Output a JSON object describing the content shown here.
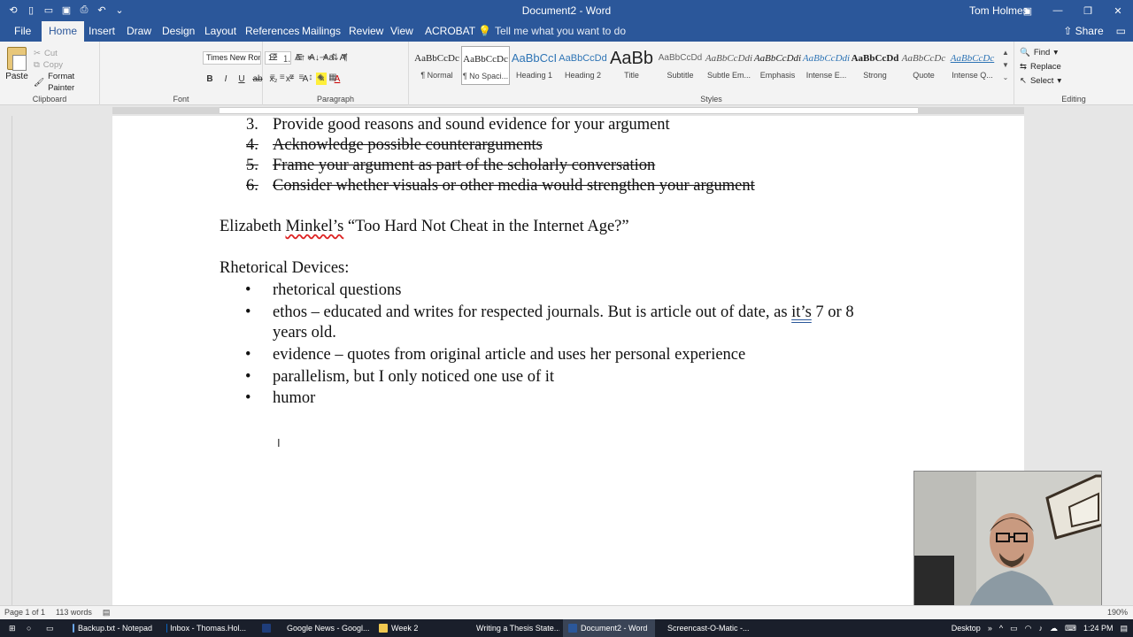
{
  "window": {
    "title": "Document2 - Word",
    "user": "Tom Holmes"
  },
  "tabs": [
    {
      "label": "File"
    },
    {
      "label": "Home"
    },
    {
      "label": "Insert"
    },
    {
      "label": "Draw"
    },
    {
      "label": "Design"
    },
    {
      "label": "Layout"
    },
    {
      "label": "References"
    },
    {
      "label": "Mailings"
    },
    {
      "label": "Review"
    },
    {
      "label": "View"
    },
    {
      "label": "ACROBAT"
    }
  ],
  "tell_me": "Tell me what you want to do",
  "share_label": "Share",
  "ribbon": {
    "clipboard": {
      "paste": "Paste",
      "cut": "Cut",
      "copy": "Copy",
      "format_painter": "Format Painter",
      "label": "Clipboard"
    },
    "font": {
      "name": "Times New Roman",
      "size": "12",
      "label": "Font"
    },
    "paragraph": {
      "label": "Paragraph"
    },
    "styles": {
      "label": "Styles",
      "items": [
        {
          "preview": "AaBbCcDc",
          "name": "¶ Normal"
        },
        {
          "preview": "AaBbCcDc",
          "name": "¶ No Spaci..."
        },
        {
          "preview": "AaBbCcI",
          "name": "Heading 1"
        },
        {
          "preview": "AaBbCcDd",
          "name": "Heading 2"
        },
        {
          "preview": "AaBb",
          "name": "Title"
        },
        {
          "preview": "AaBbCcDd",
          "name": "Subtitle"
        },
        {
          "preview": "AaBbCcDdi",
          "name": "Subtle Em..."
        },
        {
          "preview": "AaBbCcDdi",
          "name": "Emphasis"
        },
        {
          "preview": "AaBbCcDdi",
          "name": "Intense E..."
        },
        {
          "preview": "AaBbCcDd",
          "name": "Strong"
        },
        {
          "preview": "AaBbCcDc",
          "name": "Quote"
        },
        {
          "preview": "AaBbCcDc",
          "name": "Intense Q..."
        }
      ]
    },
    "editing": {
      "find": "Find",
      "replace": "Replace",
      "select": "Select",
      "label": "Editing"
    }
  },
  "document": {
    "numbered": [
      {
        "num": "3.",
        "text": "Provide good reasons and sound evidence for your argument",
        "strike": false
      },
      {
        "num": "4.",
        "text": "Acknowledge possible counterarguments",
        "strike": true
      },
      {
        "num": "5.",
        "text": "Frame your argument as part of the scholarly conversation",
        "strike": true
      },
      {
        "num": "6.",
        "text": "Consider whether visuals or other media would strengthen your argument",
        "strike": true
      }
    ],
    "source_prefix": "Elizabeth ",
    "source_name": "Minkel’s",
    "source_rest": " “Too Hard Not Cheat in the Internet Age?”",
    "heading": "Rhetorical Devices:",
    "bullets": {
      "b1": "rhetorical questions",
      "b2_a": "ethos – educated and writes for respected journals. But is article out of date, as ",
      "b2_b": "it’s",
      "b2_c": " 7 or 8",
      "b2_cont": "years old.",
      "b3": "evidence – quotes from original article and uses her personal experience",
      "b4": "parallelism, but I only noticed one use of it",
      "b5": "humor"
    }
  },
  "status": {
    "page": "Page 1 of 1",
    "words": "113 words",
    "zoom": "190%"
  },
  "taskbar": {
    "items": [
      {
        "label": "Backup.txt - Notepad"
      },
      {
        "label": "Inbox - Thomas.Hol..."
      },
      {
        "label": "Google News - Googl..."
      },
      {
        "label": "Week 2"
      },
      {
        "label": "Writing a Thesis State..."
      },
      {
        "label": "Document2 - Word"
      },
      {
        "label": "Screencast-O-Matic -..."
      }
    ],
    "desktop": "Desktop",
    "time": "1:24 PM"
  }
}
